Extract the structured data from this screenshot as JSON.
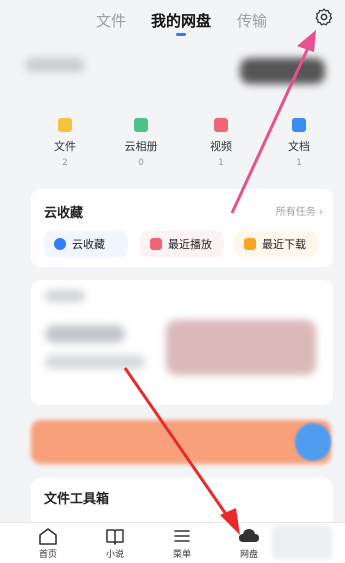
{
  "top_tabs": {
    "files": "文件",
    "my_disk": "我的网盘",
    "transfer": "传输"
  },
  "categories": [
    {
      "label": "文件",
      "count": "2",
      "color": "#f9c23c"
    },
    {
      "label": "云相册",
      "count": "0",
      "color": "#4cc38a"
    },
    {
      "label": "视频",
      "count": "1",
      "color": "#f0647a"
    },
    {
      "label": "文档",
      "count": "1",
      "color": "#3c8cf5"
    }
  ],
  "cloud_fav": {
    "title": "云收藏",
    "all_tasks": "所有任务 ›",
    "items": [
      {
        "label": "云收藏",
        "color": "#2f7cf6"
      },
      {
        "label": "最近播放",
        "color": "#f0647a"
      },
      {
        "label": "最近下载",
        "color": "#f5a623"
      }
    ]
  },
  "tools": {
    "title": "文件工具箱"
  },
  "bottom_nav": [
    {
      "label": "首页"
    },
    {
      "label": "小说"
    },
    {
      "label": "菜单"
    },
    {
      "label": "网盘"
    }
  ],
  "colors": {
    "accent": "#2f7cf6",
    "arrow_pink": "#e8508f",
    "arrow_red": "#e82a2a"
  }
}
